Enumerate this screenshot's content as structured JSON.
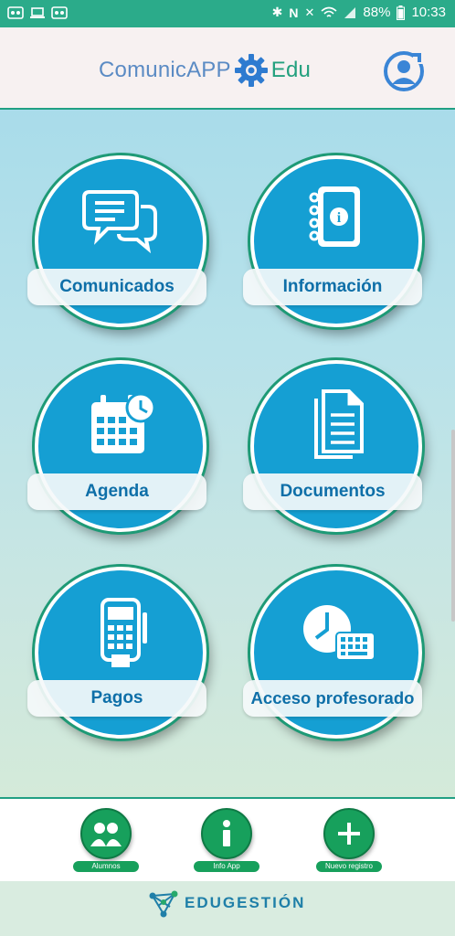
{
  "status_bar": {
    "battery": "88%",
    "time": "10:33"
  },
  "header": {
    "brand_left": "ComunicAPP",
    "brand_right": "Edu"
  },
  "tiles": [
    {
      "label": "Comunicados",
      "icon": "chat-bubbles-icon"
    },
    {
      "label": "Información",
      "icon": "address-book-icon"
    },
    {
      "label": "Agenda",
      "icon": "calendar-clock-icon"
    },
    {
      "label": "Documentos",
      "icon": "documents-icon"
    },
    {
      "label": "Pagos",
      "icon": "card-terminal-icon"
    },
    {
      "label": "Acceso profesorado",
      "icon": "clock-keyboard-icon"
    }
  ],
  "bottom_nav": [
    {
      "label": "Alumnos",
      "icon": "students-icon"
    },
    {
      "label": "Info App",
      "icon": "info-icon"
    },
    {
      "label": "Nuevo registro",
      "icon": "plus-icon"
    }
  ],
  "footer": {
    "logo_text": "EDUGESTIÓN"
  },
  "colors": {
    "status_bar": "#2bab8a",
    "tile_blue": "#159fd3",
    "tile_ring": "#1e9a76",
    "label_text": "#0e6fa8",
    "nav_green": "#17a05c"
  }
}
